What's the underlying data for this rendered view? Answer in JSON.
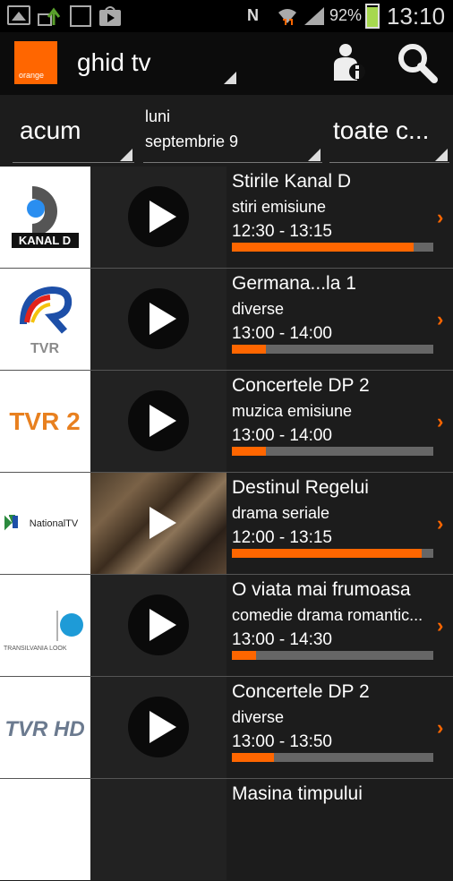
{
  "status_bar": {
    "battery": "92%",
    "battery_level": 0.92,
    "time": "13:10",
    "icons": [
      "image-icon",
      "upload-icon",
      "sim-card-icon",
      "play-store-icon",
      "nfc-icon",
      "wifi-icon",
      "battery-icon"
    ],
    "nfc_letter": "N"
  },
  "action_bar": {
    "logo_text": "orange",
    "title": "ghid tv"
  },
  "filters": {
    "time": "acum",
    "day_line1": "luni",
    "day_line2": "septembrie 9",
    "channels": "toate c..."
  },
  "programs": [
    {
      "channel_icon": "kanal-d-logo",
      "channel_text": "KANAL D",
      "title": "Stirile Kanal D",
      "genre": "stiri emisiune",
      "time": "12:30 - 13:15",
      "progress": 0.9,
      "thumbnail": "play-icon"
    },
    {
      "channel_icon": "tvr-logo",
      "channel_text": "TVR",
      "title": "Germana...la 1",
      "genre": "diverse",
      "time": "13:00 - 14:00",
      "progress": 0.17,
      "thumbnail": "play-icon"
    },
    {
      "channel_icon": "tvr2-logo",
      "channel_text": "TVR 2",
      "title": "Concertele DP 2",
      "genre": "muzica emisiune",
      "time": "13:00 - 14:00",
      "progress": 0.17,
      "thumbnail": "play-icon"
    },
    {
      "channel_icon": "national-tv-logo",
      "channel_text": "NationalTV",
      "title": "Destinul Regelui",
      "genre": "drama seriale",
      "time": "12:00 - 13:15",
      "progress": 0.94,
      "thumbnail": "photo"
    },
    {
      "channel_icon": "transilvania-look-logo",
      "channel_text": "TRANSILVANIA LOOK",
      "title": "O viata mai frumoasa",
      "genre": "comedie drama romantic...",
      "time": "13:00 - 14:30",
      "progress": 0.12,
      "thumbnail": "play-icon"
    },
    {
      "channel_icon": "tvr-hd-logo",
      "channel_text": "TVR HD",
      "title": "Concertele DP 2",
      "genre": "diverse",
      "time": "13:00 - 13:50",
      "progress": 0.21,
      "thumbnail": "play-icon"
    },
    {
      "channel_icon": "channel-logo",
      "channel_text": "",
      "title": "Masina timpului",
      "genre": "",
      "time": "",
      "progress": 0,
      "thumbnail": "play-icon"
    }
  ],
  "colors": {
    "accent": "#ff6600",
    "background": "#1c1c1c",
    "track": "#666666"
  }
}
